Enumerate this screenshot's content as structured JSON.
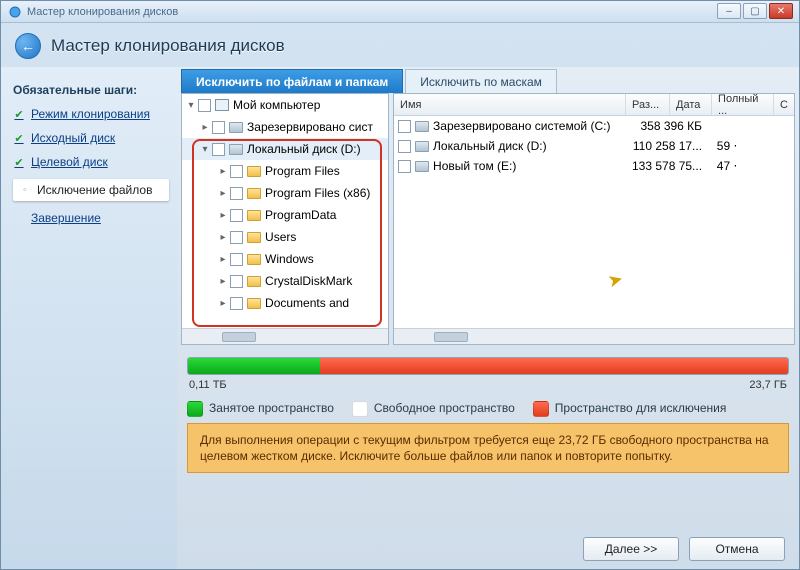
{
  "window": {
    "title": "Мастер клонирования дисков"
  },
  "header": {
    "title": "Мастер клонирования дисков"
  },
  "sidebar": {
    "title": "Обязательные шаги:",
    "items": [
      {
        "label": "Режим клонирования",
        "state": "done"
      },
      {
        "label": "Исходный диск",
        "state": "done"
      },
      {
        "label": "Целевой диск",
        "state": "done"
      },
      {
        "label": "Исключение файлов",
        "state": "current"
      },
      {
        "label": "Завершение",
        "state": "future"
      }
    ]
  },
  "tabs": {
    "active": "Исключить по файлам и папкам",
    "inactive": "Исключить по маскам"
  },
  "tree": {
    "root": "Мой компьютер",
    "items": [
      {
        "label": "Зарезервировано сист",
        "kind": "drive",
        "depth": 1
      },
      {
        "label": "Локальный диск (D:)",
        "kind": "drive",
        "depth": 1,
        "expanded": true,
        "selected": true
      },
      {
        "label": "Program Files",
        "kind": "folder",
        "depth": 2
      },
      {
        "label": "Program Files (x86)",
        "kind": "folder",
        "depth": 2
      },
      {
        "label": "ProgramData",
        "kind": "folder",
        "depth": 2
      },
      {
        "label": "Users",
        "kind": "folder",
        "depth": 2
      },
      {
        "label": "Windows",
        "kind": "folder",
        "depth": 2
      },
      {
        "label": "CrystalDiskMark",
        "kind": "folder",
        "depth": 2
      },
      {
        "label": "Documents and",
        "kind": "folder",
        "depth": 2
      }
    ]
  },
  "list": {
    "columns": {
      "name": "Имя",
      "size": "Раз...",
      "date": "Дата",
      "full": "Полный ...",
      "last": "С"
    },
    "rows": [
      {
        "name": "Зарезервировано системой (C:)",
        "size": "358 396 КБ",
        "date": ""
      },
      {
        "name": "Локальный диск (D:)",
        "size": "110 258 17...",
        "date": "59 ⋅"
      },
      {
        "name": "Новый том (E:)",
        "size": "133 578 75...",
        "date": "47 ⋅"
      }
    ]
  },
  "usage": {
    "used_label": "0,11 ТБ",
    "excl_label": "23,7 ГБ",
    "used_pct": 22,
    "excl_pct": 78
  },
  "legend": {
    "used": "Занятое пространство",
    "free": "Свободное пространство",
    "excl": "Пространство для исключения"
  },
  "warning": "Для выполнения операции с текущим фильтром требуется еще 23,72 ГБ свободного пространства на целевом жестком диске. Исключите больше файлов или папок и повторите попытку.",
  "buttons": {
    "next": "Далее >>",
    "cancel": "Отмена"
  }
}
